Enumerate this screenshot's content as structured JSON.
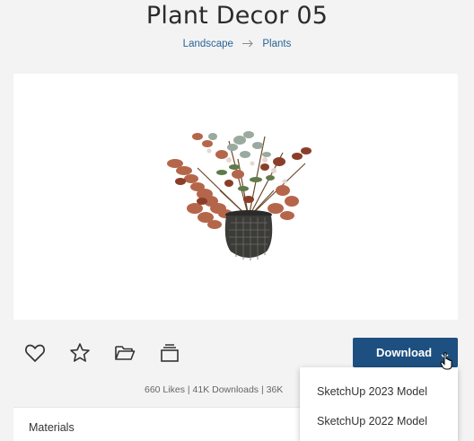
{
  "page": {
    "title": "Plant Decor 05"
  },
  "breadcrumb": {
    "items": [
      "Landscape",
      "Plants"
    ]
  },
  "actions": {
    "like_icon": "heart-outline",
    "favorite_icon": "star-outline",
    "collection_icon": "folder-outline",
    "layers_icon": "stacked-layers"
  },
  "download": {
    "label": "Download",
    "options": [
      "SketchUp 2023 Model",
      "SketchUp 2022 Model"
    ]
  },
  "stats": {
    "text": "660 Likes | 41K Downloads | 36K"
  },
  "materials": {
    "label": "Materials"
  },
  "colors": {
    "accent": "#1d4f80",
    "link": "#2a6496",
    "background": "#f3f3f4"
  }
}
